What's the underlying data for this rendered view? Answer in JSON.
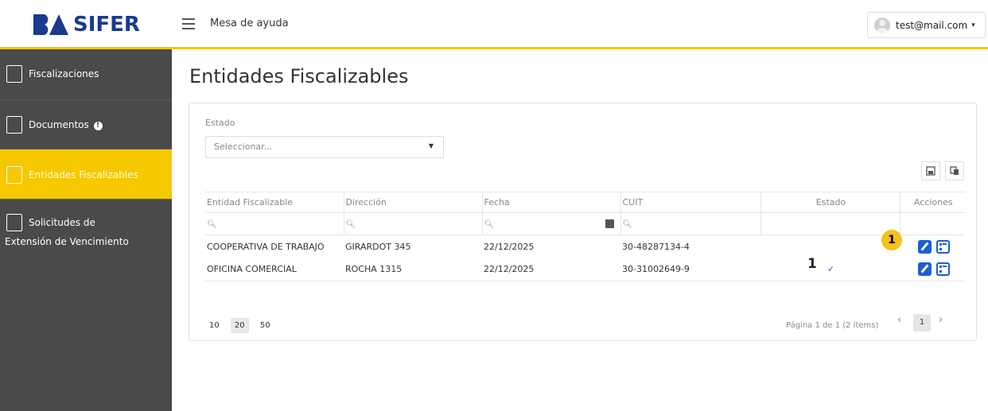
{
  "brand": {
    "name": "SIFER",
    "accent_color": "#f5c800",
    "logo_color": "#1a3a8c"
  },
  "topbar": {
    "title": "Mesa de ayuda",
    "menu_icon": "hamburger-icon"
  },
  "user": {
    "email": "test@mail.com",
    "caret": "▾"
  },
  "sidebar": {
    "items": [
      {
        "label": "Fiscalizaciones",
        "icon": "audit-document-icon",
        "active": false
      },
      {
        "label": "Documentos",
        "icon": "document-icon",
        "badge": "!",
        "active": false
      },
      {
        "label": "Entidades Fiscalizables",
        "icon": "building-icon",
        "active": true
      },
      {
        "label_line1": "Solicitudes de",
        "label_line2": "Extensión de Vencimiento",
        "icon": "calendar-clock-icon",
        "active": false
      }
    ]
  },
  "page": {
    "title": "Entidades Fiscalizables"
  },
  "filter": {
    "label": "Estado",
    "placeholder": "Seleccionar..."
  },
  "table": {
    "columns": [
      "Entidad Fiscalizable",
      "Dirección",
      "Fecha",
      "CUIT",
      "Estado",
      "Acciones"
    ],
    "rows": [
      {
        "entidad": "COOPERATIVA DE TRABAJO",
        "direccion": "GIRARDOT 345",
        "fecha": "22/12/2025",
        "cuit": "30-48287134-4",
        "estado": ""
      },
      {
        "entidad": "OFICINA COMERCIAL",
        "direccion": "ROCHA 1315",
        "fecha": "22/12/2025",
        "cuit": "30-31002649-9",
        "estado": "✓"
      }
    ]
  },
  "pager": {
    "sizes": [
      "10",
      "20",
      "50"
    ],
    "active_size": "20",
    "info": "Página 1 de 1 (2 ítems)",
    "prev": "‹",
    "next": "›",
    "current_page": "1"
  },
  "annotations": {
    "yellow": "1",
    "plain": "1"
  }
}
